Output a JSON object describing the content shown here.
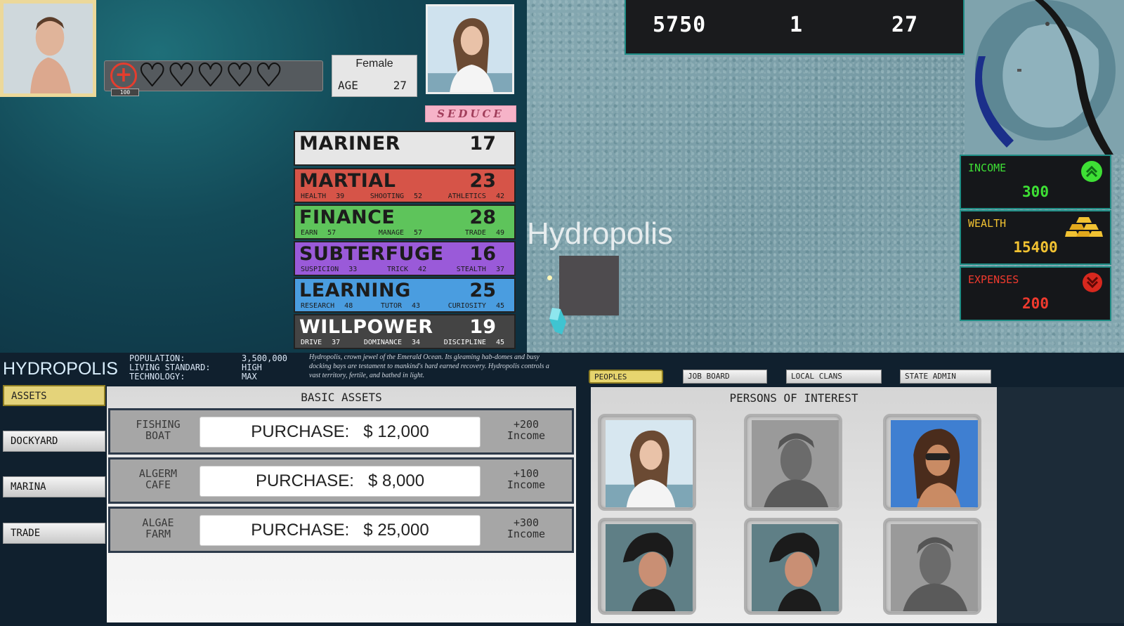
{
  "player": {
    "health_value": "100"
  },
  "npc": {
    "gender": "Female",
    "age_label": "AGE",
    "age": "27",
    "seduce_label": "SEDUCE"
  },
  "stats": [
    {
      "name": "MARINER",
      "value": "17",
      "subs": []
    },
    {
      "name": "MARTIAL",
      "value": "23",
      "subs": [
        {
          "label": "HEALTH",
          "value": "39"
        },
        {
          "label": "SHOOTING",
          "value": "52"
        },
        {
          "label": "ATHLETICS",
          "value": "42"
        }
      ]
    },
    {
      "name": "FINANCE",
      "value": "28",
      "subs": [
        {
          "label": "EARN",
          "value": "57"
        },
        {
          "label": "MANAGE",
          "value": "57"
        },
        {
          "label": "TRADE",
          "value": "49"
        }
      ]
    },
    {
      "name": "SUBTERFUGE",
      "value": "16",
      "subs": [
        {
          "label": "SUSPICION",
          "value": "33"
        },
        {
          "label": "TRICK",
          "value": "42"
        },
        {
          "label": "STEALTH",
          "value": "37"
        }
      ]
    },
    {
      "name": "LEARNING",
      "value": "25",
      "subs": [
        {
          "label": "RESEARCH",
          "value": "48"
        },
        {
          "label": "TUTOR",
          "value": "43"
        },
        {
          "label": "CURIOSITY",
          "value": "45"
        }
      ]
    },
    {
      "name": "WILLPOWER",
      "value": "19",
      "subs": [
        {
          "label": "DRIVE",
          "value": "37"
        },
        {
          "label": "DOMINANCE",
          "value": "34"
        },
        {
          "label": "DISCIPLINE",
          "value": "45"
        }
      ]
    }
  ],
  "topbar": {
    "value1": "5750",
    "value2": "1",
    "value3": "27"
  },
  "map": {
    "city_label": "Hydropolis"
  },
  "economy": {
    "income_label": "INCOME",
    "income": "300",
    "wealth_label": "WEALTH",
    "wealth": "15400",
    "expenses_label": "EXPENSES",
    "expenses": "200",
    "colors": {
      "income": "#3ee035",
      "wealth": "#f1c232",
      "expenses": "#f03a2e"
    }
  },
  "city": {
    "name": "HYDROPOLIS",
    "population_label": "POPULATION:",
    "population": "3,500,000",
    "living_label": "LIVING STANDARD:",
    "living": "HIGH",
    "technology_label": "TECHNOLOGY:",
    "technology": "MAX",
    "description": "Hydropolis, crown jewel of the Emerald Ocean. Its gleaming hab-domes and busy docking bays are testament to mankind's hard earned recovery. Hydropolis controls a vast territory, fertile, and bathed in light."
  },
  "side_menu": [
    "ASSETS",
    "DOCKYARD",
    "MARINA",
    "TRADE"
  ],
  "assets": {
    "title": "BASIC ASSETS",
    "items": [
      {
        "name_l1": "FISHING",
        "name_l2": "BOAT",
        "purchase_label": "PURCHASE:",
        "price": "$ 12,000",
        "income_l1": "+200",
        "income_l2": "Income"
      },
      {
        "name_l1": "ALGERM",
        "name_l2": "CAFE",
        "purchase_label": "PURCHASE:",
        "price": "$ 8,000",
        "income_l1": "+100",
        "income_l2": "Income"
      },
      {
        "name_l1": "ALGAE",
        "name_l2": "FARM",
        "purchase_label": "PURCHASE:",
        "price": "$ 25,000",
        "income_l1": "+300",
        "income_l2": "Income"
      }
    ]
  },
  "tabs": [
    "PEOPLES",
    "JOB BOARD",
    "LOCAL CLANS",
    "STATE ADMIN"
  ],
  "poi": {
    "title": "PERSONS OF INTEREST"
  }
}
